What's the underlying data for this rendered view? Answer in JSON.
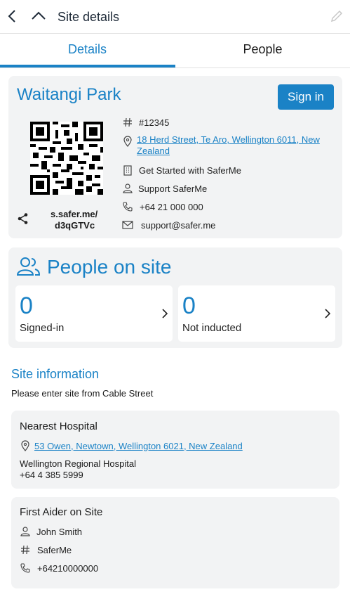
{
  "header": {
    "title": "Site details"
  },
  "tabs": [
    {
      "label": "Details"
    },
    {
      "label": "People"
    }
  ],
  "site": {
    "name": "Waitangi Park",
    "sign_in_label": "Sign in",
    "short_link_line1": "s.safer.me/",
    "short_link_line2": "d3qGTVc",
    "site_id": "#12345",
    "address_line1": "18 Herd Street, Te Aro, Wellington 6011, New",
    "address_line2": "Zealand",
    "organisation": "Get Started with SaferMe",
    "contact_name": "Support SaferMe",
    "phone": "+64 21 000 000",
    "email": "support@safer.me"
  },
  "people_on_site": {
    "title": "People on site",
    "signed_in_count": "0",
    "signed_in_label": "Signed-in",
    "not_inducted_count": "0",
    "not_inducted_label": "Not inducted"
  },
  "site_information": {
    "heading": "Site information",
    "instructions": "Please enter site from Cable Street"
  },
  "nearest_hospital": {
    "heading": "Nearest Hospital",
    "address": "53 Owen, Newtown, Wellington 6021, New Zealand",
    "name": "Wellington Regional Hospital",
    "phone": "+64 4 385 5999"
  },
  "first_aider": {
    "heading": "First Aider on Site",
    "name": "John Smith",
    "organisation": "SaferMe",
    "phone": "+64210000000"
  },
  "colors": {
    "accent": "#1a82c6",
    "card_bg": "#f2f3f4"
  }
}
